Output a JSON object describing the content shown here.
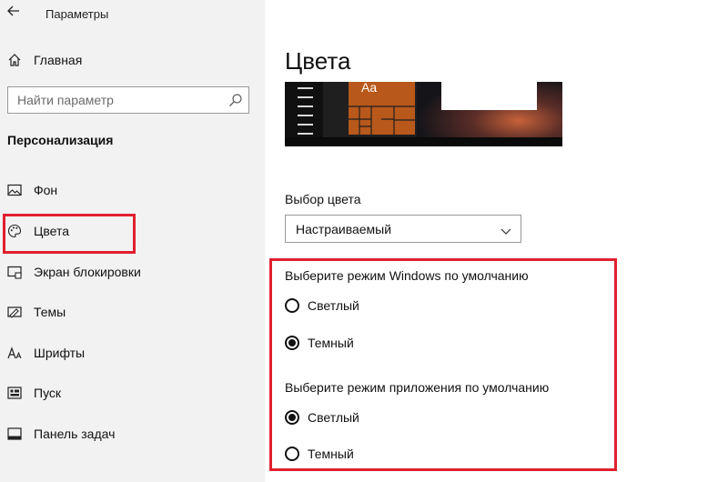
{
  "app_title": "Параметры",
  "nav": {
    "home_label": "Главная",
    "search_placeholder": "Найти параметр",
    "section_title": "Персонализация",
    "items": [
      {
        "label": "Фон",
        "icon": "picture-icon"
      },
      {
        "label": "Цвета",
        "icon": "palette-icon"
      },
      {
        "label": "Экран блокировки",
        "icon": "lock-screen-icon"
      },
      {
        "label": "Темы",
        "icon": "themes-icon"
      },
      {
        "label": "Шрифты",
        "icon": "fonts-icon"
      },
      {
        "label": "Пуск",
        "icon": "start-icon"
      },
      {
        "label": "Панель задач",
        "icon": "taskbar-icon"
      }
    ]
  },
  "main": {
    "title": "Цвета",
    "preview_text": "Aa",
    "color_choice_label": "Выбор цвета",
    "color_choice_value": "Настраиваемый",
    "windows_mode": {
      "label": "Выберите режим Windows по умолчанию",
      "options": [
        "Светлый",
        "Темный"
      ],
      "selected": "Темный"
    },
    "app_mode": {
      "label": "Выберите режим приложения по умолчанию",
      "options": [
        "Светлый",
        "Темный"
      ],
      "selected": "Светлый"
    }
  },
  "colors": {
    "highlight_border": "#e0202e",
    "accent_tile": "#b8581b",
    "sidebar_bg": "#f2f2f2"
  }
}
